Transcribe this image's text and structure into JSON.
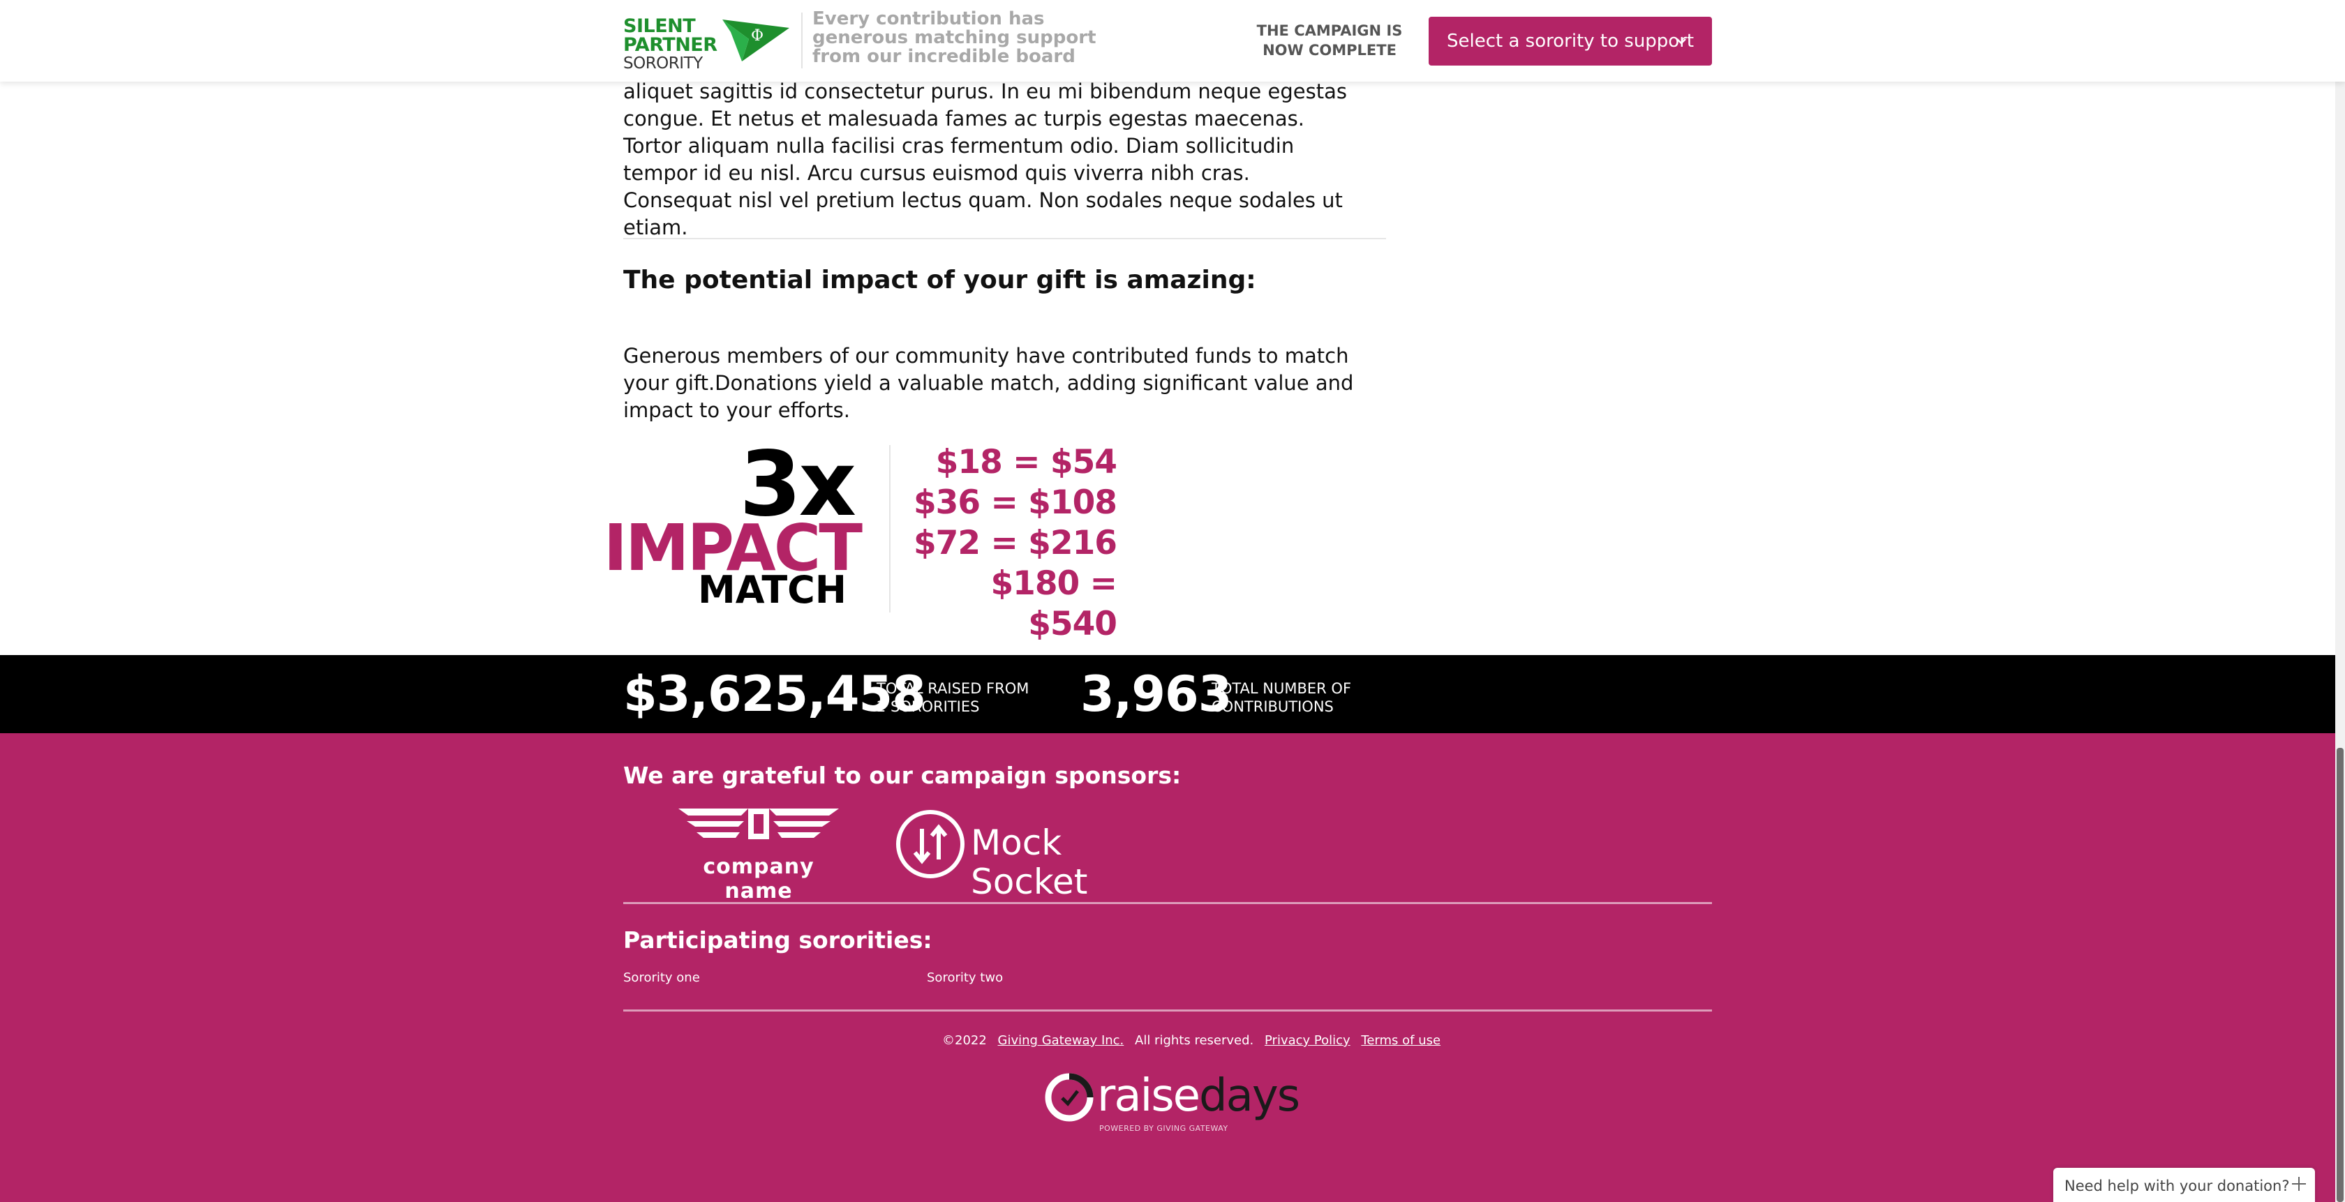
{
  "header": {
    "logo": {
      "line1": "SILENT",
      "line2": "PARTNER",
      "line3": "SORORITY",
      "symbol": "Φ"
    },
    "tagline": "Every contribution has generous matching support from our incredible board",
    "campaign_status": "THE CAMPAIGN IS NOW COMPLETE",
    "select_button_label": "Select a sorority to support",
    "select_button_icon": "chevron-down-icon"
  },
  "main": {
    "intro_text": "aliquet sagittis id consectetur purus. In eu mi bibendum neque egestas congue. Et netus et malesuada fames ac turpis egestas maecenas. Tortor aliquam nulla facilisi cras fermentum odio. Diam sollicitudin tempor id eu nisl. Arcu cursus euismod quis viverra nibh cras. Consequat nisl vel pretium lectus quam. Non sodales neque sodales ut etiam.",
    "impact_heading": "The potential impact of your gift is amazing:",
    "impact_description": "Generous members of our community have contributed funds to match your gift.Donations yield a valuable match, adding significant value and impact to your efforts.",
    "impact_graphic": {
      "multiplier": "3x",
      "word1": "IMPACT",
      "word2": "MATCH"
    },
    "match_examples": [
      "$18 = $54",
      "$36 = $108",
      "$72 = $216",
      "$180 = $540"
    ]
  },
  "stats": {
    "total_raised": "$3,625,458",
    "total_raised_label_1": "TOTAL RAISED FROM",
    "total_raised_label_2": "2 SORORITIES",
    "contributions": "3,963",
    "contributions_label_1": "TOTAL NUMBER OF",
    "contributions_label_2": "CONTRIBUTIONS"
  },
  "footer": {
    "sponsors_heading": "We are grateful to our campaign sponsors:",
    "sponsors": [
      {
        "name": "company name",
        "icon": "winged-logo-icon"
      },
      {
        "name": "Mock Socket",
        "icon": "arrows-circle-icon"
      }
    ],
    "participating_heading": "Participating sororities:",
    "sororities": [
      "Sorority one",
      "Sorority two"
    ],
    "copyright": "©2022",
    "company_link": "Giving Gateway Inc.",
    "rights": "All rights reserved.",
    "privacy_link": "Privacy Policy",
    "terms_link": "Terms of use",
    "brand": {
      "part1": "raise",
      "part2": "days",
      "tagline": "POWERED BY GIVING GATEWAY"
    }
  },
  "help_widget": {
    "label": "Need help with your donation?",
    "icon": "plus-icon"
  },
  "colors": {
    "brand": "#b32466",
    "stats_bg": "#000000",
    "logo_green": "#1e8f2d"
  }
}
